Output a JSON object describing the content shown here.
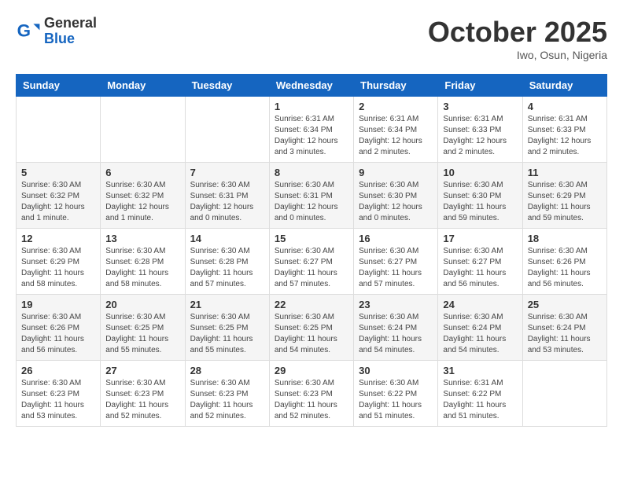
{
  "header": {
    "logo_general": "General",
    "logo_blue": "Blue",
    "month": "October 2025",
    "location": "Iwo, Osun, Nigeria"
  },
  "days_of_week": [
    "Sunday",
    "Monday",
    "Tuesday",
    "Wednesday",
    "Thursday",
    "Friday",
    "Saturday"
  ],
  "weeks": [
    {
      "shaded": false,
      "days": [
        {
          "num": "",
          "info": ""
        },
        {
          "num": "",
          "info": ""
        },
        {
          "num": "",
          "info": ""
        },
        {
          "num": "1",
          "info": "Sunrise: 6:31 AM\nSunset: 6:34 PM\nDaylight: 12 hours and 3 minutes."
        },
        {
          "num": "2",
          "info": "Sunrise: 6:31 AM\nSunset: 6:34 PM\nDaylight: 12 hours and 2 minutes."
        },
        {
          "num": "3",
          "info": "Sunrise: 6:31 AM\nSunset: 6:33 PM\nDaylight: 12 hours and 2 minutes."
        },
        {
          "num": "4",
          "info": "Sunrise: 6:31 AM\nSunset: 6:33 PM\nDaylight: 12 hours and 2 minutes."
        }
      ]
    },
    {
      "shaded": true,
      "days": [
        {
          "num": "5",
          "info": "Sunrise: 6:30 AM\nSunset: 6:32 PM\nDaylight: 12 hours and 1 minute."
        },
        {
          "num": "6",
          "info": "Sunrise: 6:30 AM\nSunset: 6:32 PM\nDaylight: 12 hours and 1 minute."
        },
        {
          "num": "7",
          "info": "Sunrise: 6:30 AM\nSunset: 6:31 PM\nDaylight: 12 hours and 0 minutes."
        },
        {
          "num": "8",
          "info": "Sunrise: 6:30 AM\nSunset: 6:31 PM\nDaylight: 12 hours and 0 minutes."
        },
        {
          "num": "9",
          "info": "Sunrise: 6:30 AM\nSunset: 6:30 PM\nDaylight: 12 hours and 0 minutes."
        },
        {
          "num": "10",
          "info": "Sunrise: 6:30 AM\nSunset: 6:30 PM\nDaylight: 11 hours and 59 minutes."
        },
        {
          "num": "11",
          "info": "Sunrise: 6:30 AM\nSunset: 6:29 PM\nDaylight: 11 hours and 59 minutes."
        }
      ]
    },
    {
      "shaded": false,
      "days": [
        {
          "num": "12",
          "info": "Sunrise: 6:30 AM\nSunset: 6:29 PM\nDaylight: 11 hours and 58 minutes."
        },
        {
          "num": "13",
          "info": "Sunrise: 6:30 AM\nSunset: 6:28 PM\nDaylight: 11 hours and 58 minutes."
        },
        {
          "num": "14",
          "info": "Sunrise: 6:30 AM\nSunset: 6:28 PM\nDaylight: 11 hours and 57 minutes."
        },
        {
          "num": "15",
          "info": "Sunrise: 6:30 AM\nSunset: 6:27 PM\nDaylight: 11 hours and 57 minutes."
        },
        {
          "num": "16",
          "info": "Sunrise: 6:30 AM\nSunset: 6:27 PM\nDaylight: 11 hours and 57 minutes."
        },
        {
          "num": "17",
          "info": "Sunrise: 6:30 AM\nSunset: 6:27 PM\nDaylight: 11 hours and 56 minutes."
        },
        {
          "num": "18",
          "info": "Sunrise: 6:30 AM\nSunset: 6:26 PM\nDaylight: 11 hours and 56 minutes."
        }
      ]
    },
    {
      "shaded": true,
      "days": [
        {
          "num": "19",
          "info": "Sunrise: 6:30 AM\nSunset: 6:26 PM\nDaylight: 11 hours and 56 minutes."
        },
        {
          "num": "20",
          "info": "Sunrise: 6:30 AM\nSunset: 6:25 PM\nDaylight: 11 hours and 55 minutes."
        },
        {
          "num": "21",
          "info": "Sunrise: 6:30 AM\nSunset: 6:25 PM\nDaylight: 11 hours and 55 minutes."
        },
        {
          "num": "22",
          "info": "Sunrise: 6:30 AM\nSunset: 6:25 PM\nDaylight: 11 hours and 54 minutes."
        },
        {
          "num": "23",
          "info": "Sunrise: 6:30 AM\nSunset: 6:24 PM\nDaylight: 11 hours and 54 minutes."
        },
        {
          "num": "24",
          "info": "Sunrise: 6:30 AM\nSunset: 6:24 PM\nDaylight: 11 hours and 54 minutes."
        },
        {
          "num": "25",
          "info": "Sunrise: 6:30 AM\nSunset: 6:24 PM\nDaylight: 11 hours and 53 minutes."
        }
      ]
    },
    {
      "shaded": false,
      "days": [
        {
          "num": "26",
          "info": "Sunrise: 6:30 AM\nSunset: 6:23 PM\nDaylight: 11 hours and 53 minutes."
        },
        {
          "num": "27",
          "info": "Sunrise: 6:30 AM\nSunset: 6:23 PM\nDaylight: 11 hours and 52 minutes."
        },
        {
          "num": "28",
          "info": "Sunrise: 6:30 AM\nSunset: 6:23 PM\nDaylight: 11 hours and 52 minutes."
        },
        {
          "num": "29",
          "info": "Sunrise: 6:30 AM\nSunset: 6:23 PM\nDaylight: 11 hours and 52 minutes."
        },
        {
          "num": "30",
          "info": "Sunrise: 6:30 AM\nSunset: 6:22 PM\nDaylight: 11 hours and 51 minutes."
        },
        {
          "num": "31",
          "info": "Sunrise: 6:31 AM\nSunset: 6:22 PM\nDaylight: 11 hours and 51 minutes."
        },
        {
          "num": "",
          "info": ""
        }
      ]
    }
  ]
}
